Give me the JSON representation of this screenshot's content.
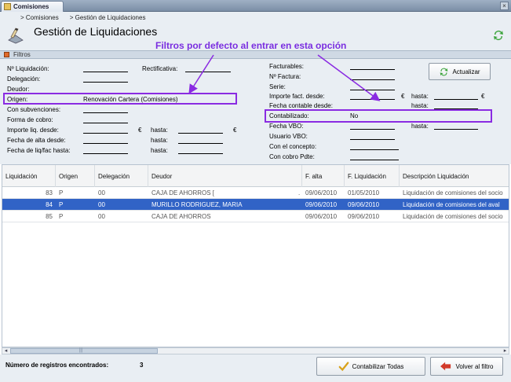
{
  "window": {
    "tab_title": "Comisiones",
    "close": "×"
  },
  "header": {
    "breadcrumb": [
      "Comisiones",
      "Gestión de Liquidaciones"
    ],
    "title": "Gestión de Liquidaciones",
    "annotation": "Filtros por defecto al entrar en esta opción"
  },
  "filters": {
    "section_title": "Filtros",
    "left": {
      "n_liquidacion": "Nº Liquidación:",
      "rectificativa": "Rectificativa:",
      "delegacion": "Delegación:",
      "deudor": "Deudor:",
      "origen": "Origen:",
      "origen_value": "Renovación Cartera (Comisiones)",
      "con_subvenciones": "Con subvenciones:",
      "forma_cobro": "Forma de cobro:",
      "importe_liq_desde": "Importe liq. desde:",
      "hasta": "hasta:",
      "currency": "€",
      "fecha_alta_desde": "Fecha de alta desde:",
      "fecha_liq_hasta": "Fecha de liq/fac hasta:"
    },
    "right": {
      "facturables": "Facturables:",
      "n_factura": "Nº Factura:",
      "serie": "Serie:",
      "importe_fact_desde": "Importe fact. desde:",
      "fecha_contable_desde": "Fecha contable desde:",
      "contabilizado": "Contabilizado:",
      "contabilizado_value": "No",
      "fecha_vbo": "Fecha VBO:",
      "usuario_vbo": "Usuario VBO:",
      "con_concepto": "Con el concepto:",
      "con_cobro_pdte": "Con cobro Pdte:",
      "hasta": "hasta:",
      "currency": "€"
    },
    "actualizar": "Actualizar"
  },
  "grid": {
    "columns": [
      "Liquidación",
      "Origen",
      "Delegación",
      "Deudor",
      "F. alta",
      "F. Liquidación",
      "Descripción Liquidación"
    ],
    "rows": [
      {
        "liquidacion": "83",
        "origen": "P",
        "delegacion": "00",
        "deudor": "CAJA DE AHORROS [",
        "mark": ".",
        "f_alta": "09/06/2010",
        "f_liq": "01/05/2010",
        "descripcion": "Liquidación de comisiones del socio",
        "selected": false
      },
      {
        "liquidacion": "84",
        "origen": "P",
        "delegacion": "00",
        "deudor": "MURILLO RODRIGUEZ, MARIA",
        "mark": "",
        "f_alta": "09/06/2010",
        "f_liq": "09/06/2010",
        "descripcion": "Liquidación de comisiones del aval",
        "selected": true
      },
      {
        "liquidacion": "85",
        "origen": "P",
        "delegacion": "00",
        "deudor": "CAJA DE AHORROS",
        "mark": "",
        "f_alta": "09/06/2010",
        "f_liq": "09/06/2010",
        "descripcion": "Liquidación de comisiones del socio",
        "selected": false
      }
    ],
    "hscroll_mark": "|||"
  },
  "footer": {
    "count_label": "Número de registros encontrados:",
    "count_value": "3",
    "contabilizar": "Contabilizar Todas",
    "volver": "Volver al filtro"
  },
  "colors": {
    "annotation": "#8a2be2",
    "selection": "#3163c6"
  }
}
